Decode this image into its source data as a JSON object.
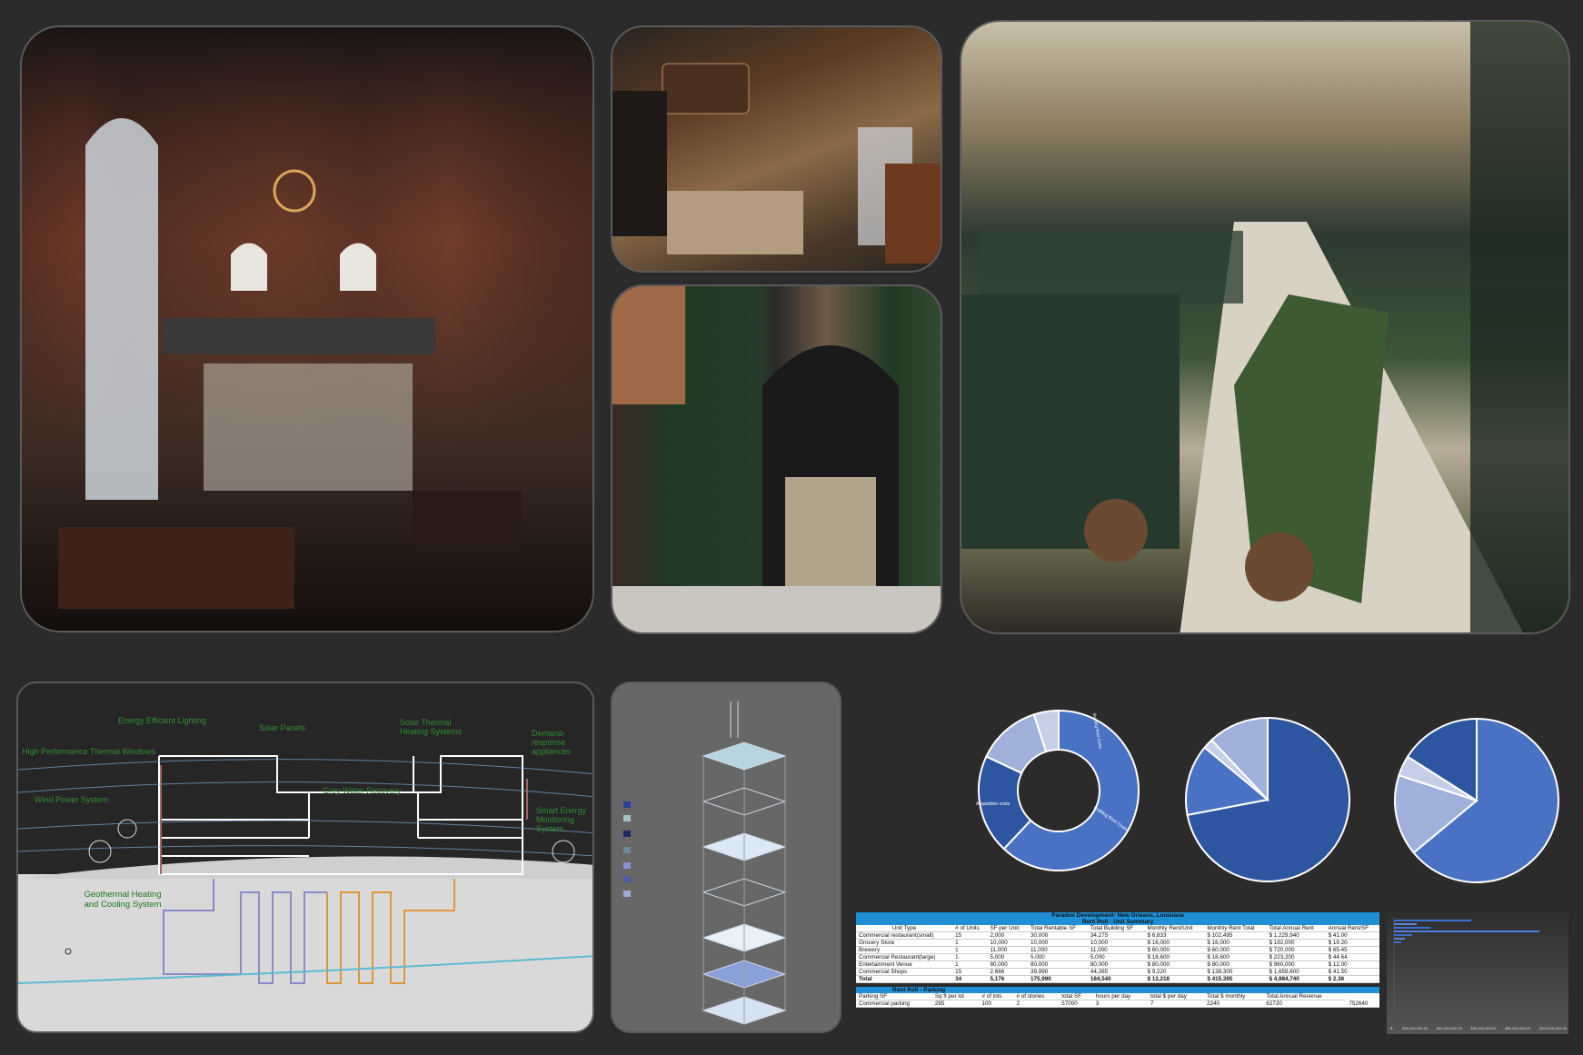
{
  "section_diagram": {
    "labels": [
      "Energy Efficient Lighting",
      "Solar Panels",
      "Solar Thermal Heating Systems",
      "Demand-response appliances",
      "High Performance Thermal Windows",
      "Grey Water Recovery",
      "Wind Power System",
      "Smart Energy Monitoring System",
      "Geothermal Heating and Cooling System"
    ]
  },
  "charts": {
    "donut_labels": [
      "Building Rent Costs",
      "Acquisition costs",
      "Building Rent Costs"
    ],
    "donut": [
      0.62,
      0.2,
      0.13,
      0.05
    ],
    "pie2": [
      0.72,
      0.14,
      0.02,
      0.12
    ],
    "pie3": [
      0.64,
      0.16,
      0.04,
      0.16
    ]
  },
  "rent_roll": {
    "title1": "Paradox Development- New Orleans, Louisiana",
    "title2": "Rent Roll - Unit Summary",
    "headers": [
      "Unit Type",
      "# of Units",
      "SF per Unit",
      "Total Rentable SF",
      "Total Building SF",
      "Monthly Rent/Unit",
      "Monthly Rent Total",
      "Total Annual Rent",
      "Annual Rent/SF"
    ],
    "rows": [
      [
        "Commercial restaurant(small)",
        "15",
        "2,000",
        "30,000",
        "34,275",
        "$ 6,833",
        "$ 102,495",
        "$ 1,229,940",
        "$ 41.00"
      ],
      [
        "Grocery Store",
        "1",
        "10,000",
        "10,000",
        "10,000",
        "$ 16,000",
        "$ 16,000",
        "$ 192,000",
        "$ 19.20"
      ],
      [
        "Brewery",
        "1",
        "11,000",
        "11,000",
        "11,000",
        "$ 60,000",
        "$ 60,000",
        "$ 720,000",
        "$ 65.45"
      ],
      [
        "Commercial Restaurant(large)",
        "1",
        "5,000",
        "5,000",
        "5,000",
        "$ 18,600",
        "$ 18,600",
        "$ 223,200",
        "$ 44.64"
      ],
      [
        "Entertainment Venue",
        "1",
        "80,000",
        "80,000",
        "80,000",
        "$ 80,000",
        "$ 80,000",
        "$ 960,000",
        "$ 12.00"
      ],
      [
        "Commercial Shops",
        "15",
        "2,666",
        "39,990",
        "44,265",
        "$ 9,220",
        "$ 138,300",
        "$ 1,659,600",
        "$ 41.50"
      ]
    ],
    "total": [
      "Total",
      "34",
      "5,176",
      "175,990",
      "184,540",
      "$ 12,218",
      "$ 415,395",
      "$ 4,984,740",
      "$ 2.36"
    ],
    "parking_title": "Rent Roll - Parking",
    "parking_headers": [
      "Parking SF",
      "Sq ft per lot",
      "# of lots",
      "# of stories",
      "total SF",
      "hours per day",
      "total $ per day",
      "Total $ monthly",
      "Total Annual Revenue"
    ],
    "parking_row": [
      "Commercial parking",
      "285",
      "100",
      "2",
      "57000",
      "3",
      "7",
      "2240",
      "62720",
      "752640"
    ]
  },
  "bar_chart": {
    "ticks": [
      "$-",
      "$20,000,000.00",
      "$40,000,000.00",
      "$60,000,000.00",
      "$80,000,000.00",
      "$100,000,000.00"
    ]
  },
  "colors": {
    "blue_dark": "#2e56a0",
    "blue_mid": "#4a72c4",
    "blue_light": "#9fb0db",
    "blue_pale": "#c6cfe8",
    "header_blue": "#1f8fd6"
  }
}
